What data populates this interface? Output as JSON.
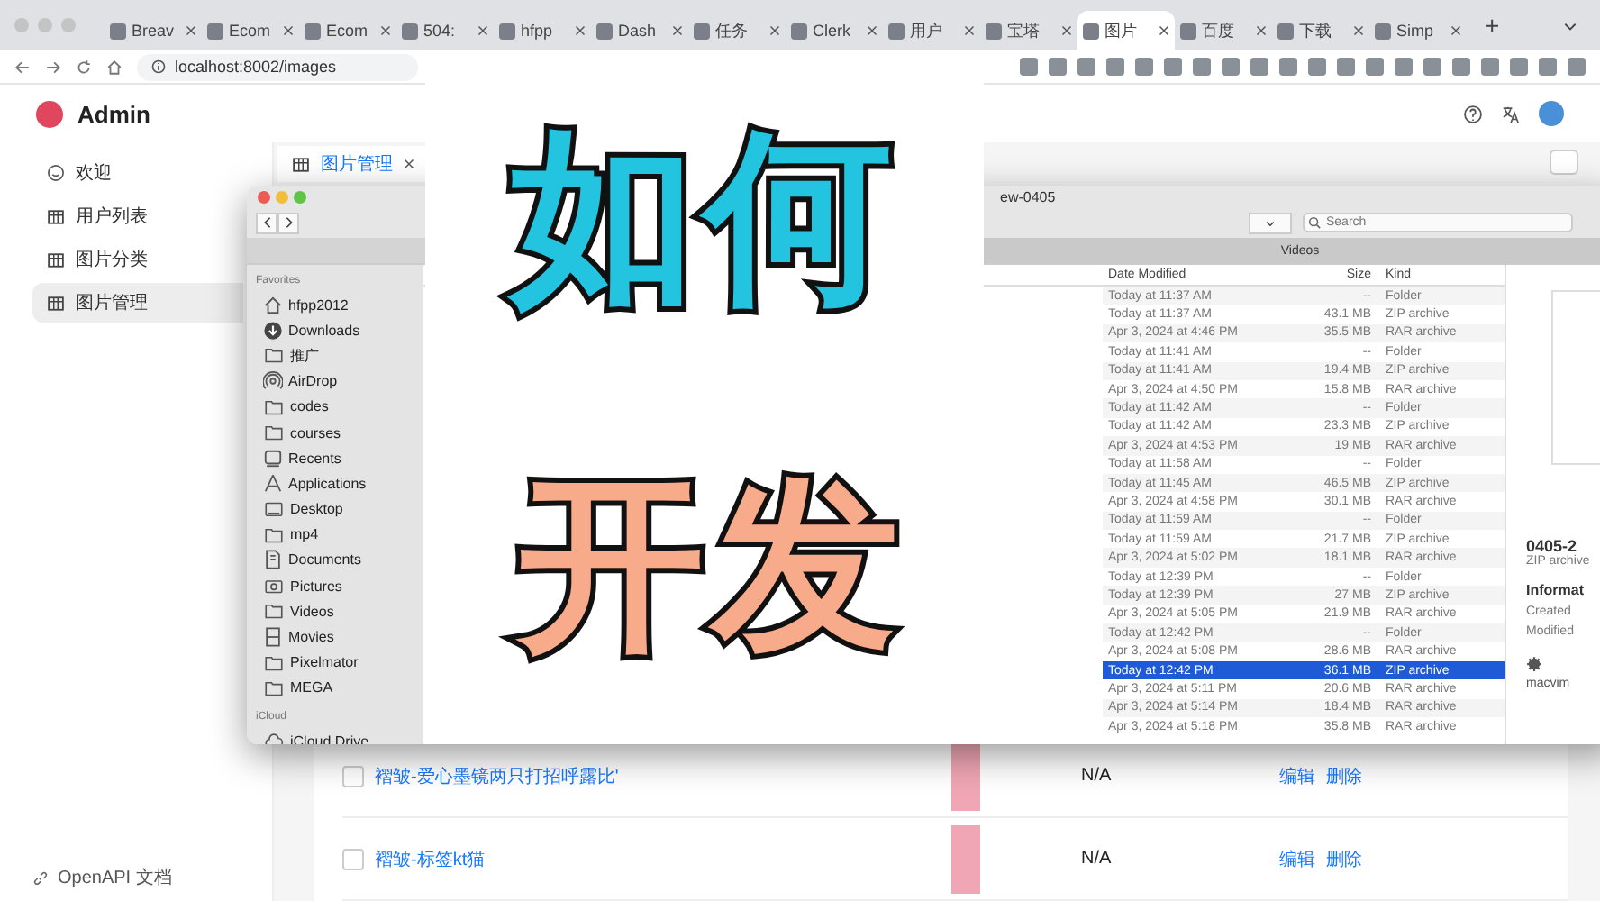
{
  "browser": {
    "tabs": [
      {
        "title": "Breav",
        "selected": false
      },
      {
        "title": "Ecom",
        "selected": false
      },
      {
        "title": "Ecom",
        "selected": false
      },
      {
        "title": "504:",
        "selected": false
      },
      {
        "title": "hfpp",
        "selected": false
      },
      {
        "title": "Dash",
        "selected": false
      },
      {
        "title": "任务",
        "selected": false
      },
      {
        "title": "Clerk",
        "selected": false
      },
      {
        "title": "用户",
        "selected": false
      },
      {
        "title": "宝塔",
        "selected": false
      },
      {
        "title": "图片",
        "selected": true
      },
      {
        "title": "百度",
        "selected": false
      },
      {
        "title": "下载",
        "selected": false
      },
      {
        "title": "Simp",
        "selected": false
      }
    ],
    "new_tab": "+",
    "address": "localhost:8002/images"
  },
  "app": {
    "title": "Admin",
    "menu": [
      {
        "label": "欢迎",
        "kind": "smile",
        "selected": false
      },
      {
        "label": "用户列表",
        "kind": "table",
        "selected": false
      },
      {
        "label": "图片分类",
        "kind": "table",
        "selected": false
      },
      {
        "label": "图片管理",
        "kind": "table",
        "selected": true
      }
    ],
    "footer_link": "OpenAPI 文档",
    "page_tabs": [
      {
        "label": "图片管理",
        "selected": true
      }
    ],
    "rows": [
      {
        "title": "褶皱-爱心墨镜两只打招呼露比'",
        "value": "N/A",
        "actions": [
          "编辑",
          "删除"
        ],
        "checked": false
      },
      {
        "title": "褶皱-标签kt猫",
        "value": "N/A",
        "actions": [
          "编辑",
          "删除"
        ],
        "checked": false
      }
    ]
  },
  "finder": {
    "title": "ew-0405",
    "search": {
      "placeholder": "Search"
    },
    "tab": "Videos",
    "sidebar": [
      {
        "heading": "Favorites",
        "items": [
          {
            "label": "hfpp2012",
            "kind": "home"
          },
          {
            "label": "Downloads",
            "kind": "download"
          },
          {
            "label": "推广",
            "kind": "folder"
          },
          {
            "label": "AirDrop",
            "kind": "airdrop"
          },
          {
            "label": "codes",
            "kind": "folder"
          },
          {
            "label": "courses",
            "kind": "folder"
          },
          {
            "label": "Recents",
            "kind": "recents"
          },
          {
            "label": "Applications",
            "kind": "apps"
          },
          {
            "label": "Desktop",
            "kind": "desktop"
          },
          {
            "label": "mp4",
            "kind": "folder"
          },
          {
            "label": "Documents",
            "kind": "documents"
          },
          {
            "label": "Pictures",
            "kind": "pictures"
          },
          {
            "label": "Videos",
            "kind": "folder"
          },
          {
            "label": "Movies",
            "kind": "movies"
          },
          {
            "label": "Pixelmator",
            "kind": "folder"
          },
          {
            "label": "MEGA",
            "kind": "folder"
          }
        ]
      },
      {
        "heading": "iCloud",
        "items": [
          {
            "label": "iCloud Drive",
            "kind": "cloud"
          }
        ]
      }
    ],
    "columns": [
      "Date Modified",
      "Size",
      "Kind"
    ],
    "files": [
      {
        "date": "Today at 11:37 AM",
        "size": "--",
        "kind": "Folder",
        "selected": false
      },
      {
        "date": "Today at 11:37 AM",
        "size": "43.1 MB",
        "kind": "ZIP archive",
        "selected": false
      },
      {
        "date": "Apr 3, 2024 at 4:46 PM",
        "size": "35.5 MB",
        "kind": "RAR archive",
        "selected": false
      },
      {
        "date": "Today at 11:41 AM",
        "size": "--",
        "kind": "Folder",
        "selected": false
      },
      {
        "date": "Today at 11:41 AM",
        "size": "19.4 MB",
        "kind": "ZIP archive",
        "selected": false
      },
      {
        "date": "Apr 3, 2024 at 4:50 PM",
        "size": "15.8 MB",
        "kind": "RAR archive",
        "selected": false
      },
      {
        "date": "Today at 11:42 AM",
        "size": "--",
        "kind": "Folder",
        "selected": false
      },
      {
        "date": "Today at 11:42 AM",
        "size": "23.3 MB",
        "kind": "ZIP archive",
        "selected": false
      },
      {
        "date": "Apr 3, 2024 at 4:53 PM",
        "size": "19 MB",
        "kind": "RAR archive",
        "selected": false
      },
      {
        "date": "Today at 11:58 AM",
        "size": "--",
        "kind": "Folder",
        "selected": false
      },
      {
        "date": "Today at 11:45 AM",
        "size": "46.5 MB",
        "kind": "ZIP archive",
        "selected": false
      },
      {
        "date": "Apr 3, 2024 at 4:58 PM",
        "size": "30.1 MB",
        "kind": "RAR archive",
        "selected": false
      },
      {
        "date": "Today at 11:59 AM",
        "size": "--",
        "kind": "Folder",
        "selected": false
      },
      {
        "date": "Today at 11:59 AM",
        "size": "21.7 MB",
        "kind": "ZIP archive",
        "selected": false
      },
      {
        "date": "Apr 3, 2024 at 5:02 PM",
        "size": "18.1 MB",
        "kind": "RAR archive",
        "selected": false
      },
      {
        "date": "Today at 12:39 PM",
        "size": "--",
        "kind": "Folder",
        "selected": false
      },
      {
        "date": "Today at 12:39 PM",
        "size": "27 MB",
        "kind": "ZIP archive",
        "selected": false
      },
      {
        "date": "Apr 3, 2024 at 5:05 PM",
        "size": "21.9 MB",
        "kind": "RAR archive",
        "selected": false
      },
      {
        "date": "Today at 12:42 PM",
        "size": "--",
        "kind": "Folder",
        "selected": false
      },
      {
        "date": "Apr 3, 2024 at 5:08 PM",
        "size": "28.6 MB",
        "kind": "RAR archive",
        "selected": false
      },
      {
        "date": "Today at 12:42 PM",
        "size": "36.1 MB",
        "kind": "ZIP archive",
        "selected": true
      },
      {
        "date": "Apr 3, 2024 at 5:11 PM",
        "size": "20.6 MB",
        "kind": "RAR archive",
        "selected": false
      },
      {
        "date": "Apr 3, 2024 at 5:14 PM",
        "size": "18.4 MB",
        "kind": "RAR archive",
        "selected": false
      },
      {
        "date": "Apr 3, 2024 at 5:18 PM",
        "size": "35.8 MB",
        "kind": "RAR archive",
        "selected": false
      }
    ],
    "preview": {
      "name": "0405-2",
      "kind": "ZIP archive",
      "section": "Informat",
      "fields": [
        "Created",
        "Modified"
      ],
      "app": "macvim"
    }
  },
  "overlay": {
    "lines": [
      {
        "text": "如何",
        "color": "#22c4e0"
      },
      {
        "text": "开发",
        "color": "#f7ab8a"
      }
    ]
  }
}
